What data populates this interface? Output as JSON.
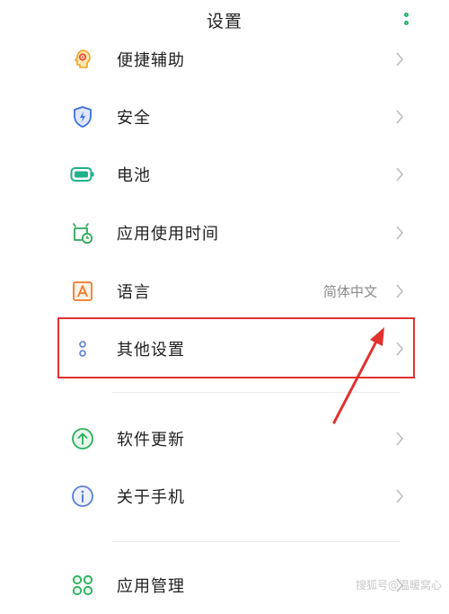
{
  "header": {
    "title": "设置",
    "more_icon": "more-vertical-icon"
  },
  "rows": [
    {
      "label": "便捷辅助",
      "value": "",
      "icon": "accessibility-head-icon"
    },
    {
      "label": "安全",
      "value": "",
      "icon": "shield-icon"
    },
    {
      "label": "电池",
      "value": "",
      "icon": "battery-icon"
    },
    {
      "label": "应用使用时间",
      "value": "",
      "icon": "app-usage-timer-icon"
    },
    {
      "label": "语言",
      "value": "简体中文",
      "icon": "language-a-icon"
    },
    {
      "label": "其他设置",
      "value": "",
      "icon": "more-settings-icon"
    },
    {
      "label": "软件更新",
      "value": "",
      "icon": "update-arrow-icon"
    },
    {
      "label": "关于手机",
      "value": "",
      "icon": "info-icon"
    },
    {
      "label": "应用管理",
      "value": "",
      "icon": "app-grid-icon"
    }
  ],
  "watermark": "搜狐号@温暖窝心",
  "colors": {
    "accent": "#1fb46a",
    "highlight": "#e0322f"
  }
}
